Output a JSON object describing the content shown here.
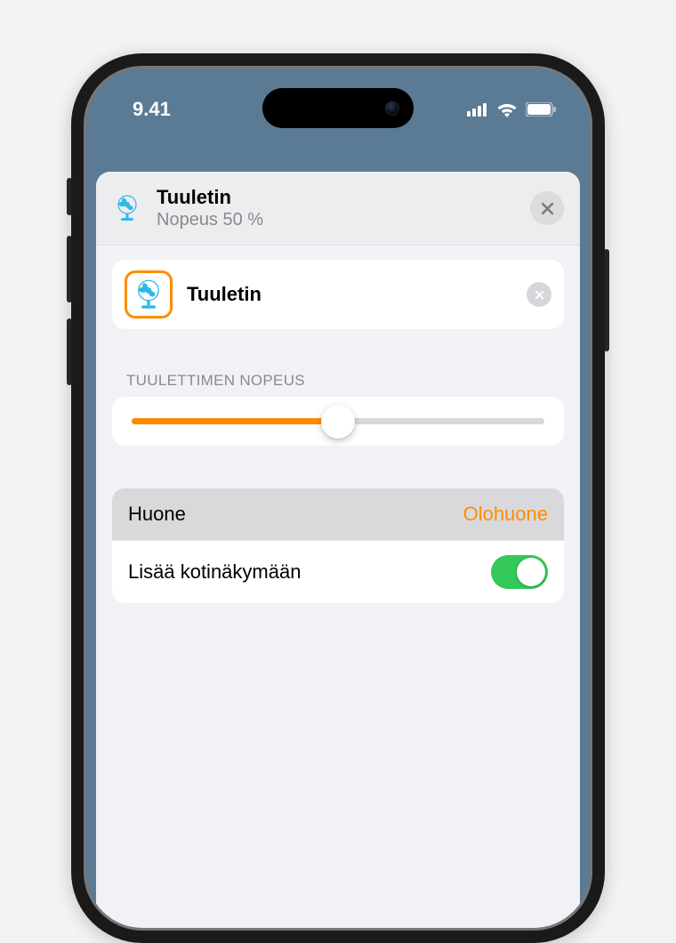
{
  "status": {
    "time": "9.41"
  },
  "header": {
    "title": "Tuuletin",
    "subtitle": "Nopeus 50 %"
  },
  "card": {
    "label": "Tuuletin"
  },
  "speed": {
    "section_label": "TUULETTIMEN NOPEUS",
    "percent": 50
  },
  "settings": {
    "room_key": "Huone",
    "room_value": "Olohuone",
    "add_home_key": "Lisää kotinäkymään",
    "add_home_on": true
  },
  "colors": {
    "accent": "#ff8c00",
    "toggle_on": "#34c759"
  }
}
